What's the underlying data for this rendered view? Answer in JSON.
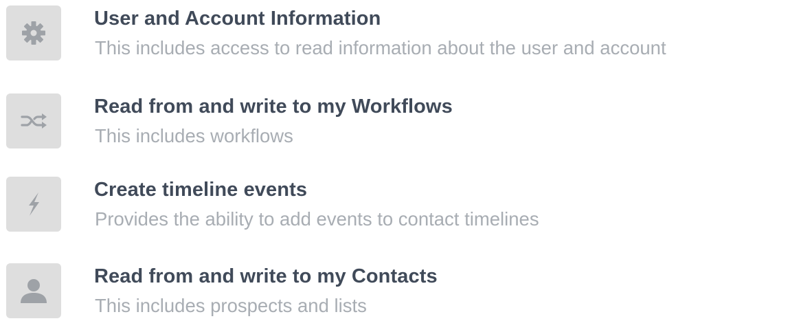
{
  "permissions": [
    {
      "icon": "gear-icon",
      "title": "User and Account Information",
      "description": "This includes access to read information about the user and account"
    },
    {
      "icon": "shuffle-icon",
      "title": "Read from and write to my Workflows",
      "description": "This includes workflows"
    },
    {
      "icon": "lightning-bolt-icon",
      "title": "Create timeline events",
      "description": "Provides the ability to add events to contact timelines"
    },
    {
      "icon": "user-icon",
      "title": "Read from and write to my Contacts",
      "description": "This includes prospects and lists"
    }
  ],
  "colors": {
    "icon_tile_bg": "#dedede",
    "icon_glyph": "#9ea2a7",
    "title": "#404a59",
    "description": "#a8adb3"
  }
}
